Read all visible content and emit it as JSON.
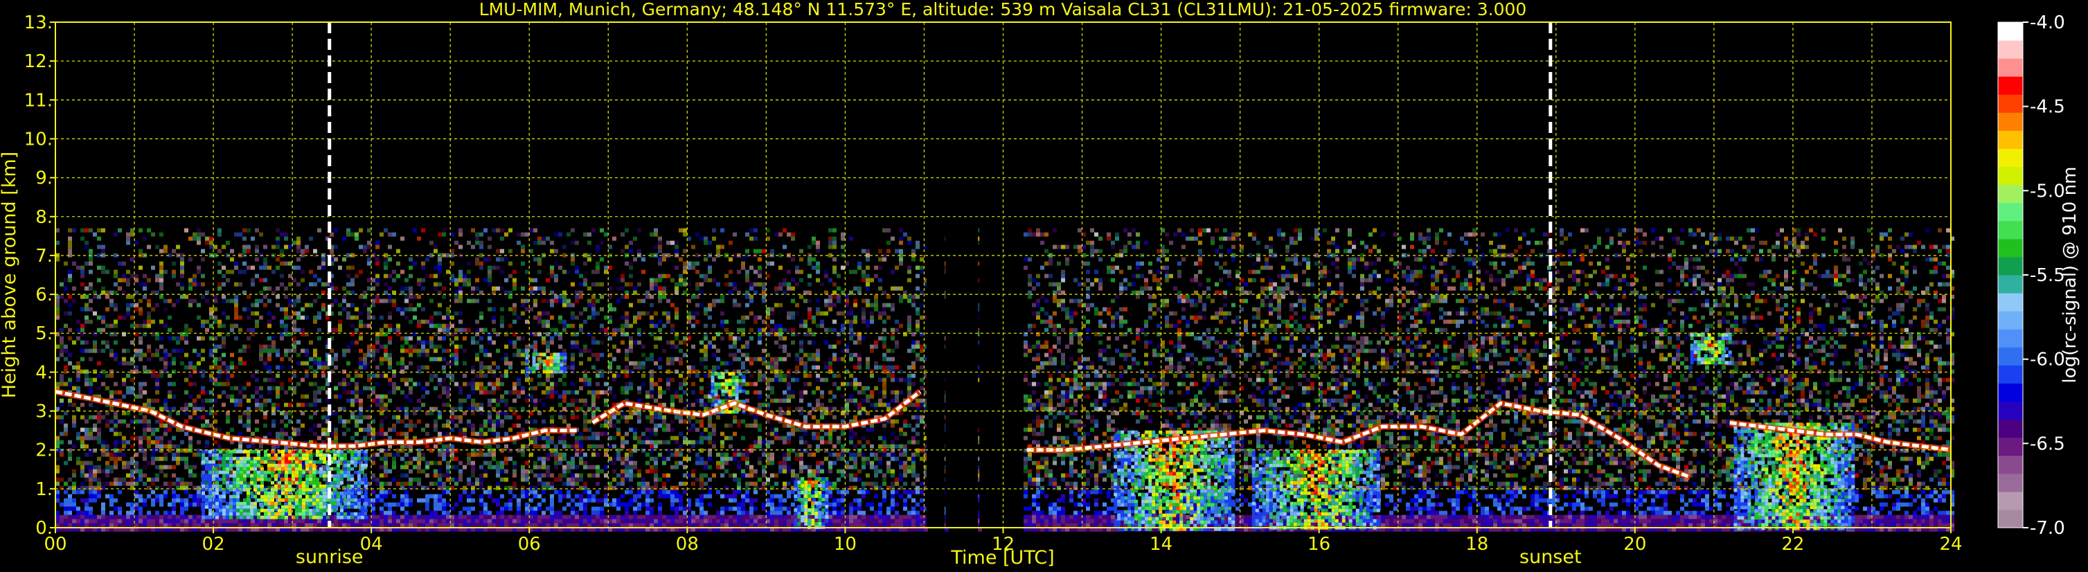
{
  "chart_data": {
    "type": "heatmap",
    "title": "LMU-MIM, Munich, Germany; 48.148° N 11.573° E, altitude: 539 m    Vaisala CL31 (CL31LMU): 21-05-2025    firmware: 3.000",
    "xlabel": "Time [UTC]",
    "ylabel": "Height above ground [km]",
    "xlim": [
      0,
      24
    ],
    "ylim": [
      0,
      13
    ],
    "x_ticks": [
      "00",
      "02",
      "04",
      "06",
      "08",
      "10",
      "12",
      "14",
      "16",
      "18",
      "20",
      "22",
      "24"
    ],
    "y_ticks": [
      "0.",
      "1.",
      "2.",
      "3.",
      "4.",
      "5.",
      "6.",
      "7.",
      "8.",
      "9.",
      "10.",
      "11.",
      "12.",
      "13."
    ],
    "grid": true,
    "colorbar": {
      "label": "log(rc-signal) @ 910 nm",
      "range": [
        -7.0,
        -4.0
      ],
      "ticks": [
        "-4.0",
        "-4.5",
        "-5.0",
        "-5.5",
        "-6.0",
        "-6.5",
        "-7.0"
      ],
      "colors": [
        "#a88aa0",
        "#b89ab0",
        "#9a6a9a",
        "#8a4a90",
        "#6a1a80",
        "#4a0080",
        "#2800c0",
        "#0000e0",
        "#1a40f0",
        "#3070f0",
        "#5090f8",
        "#70b0f8",
        "#90c8f8",
        "#30b0a0",
        "#10a050",
        "#20c020",
        "#40e050",
        "#60f080",
        "#a0f060",
        "#d0f000",
        "#f0f000",
        "#ffc000",
        "#ff8000",
        "#ff4000",
        "#ff0000",
        "#ff9090",
        "#ffc8c8",
        "#ffffff"
      ]
    },
    "measurement_top_km": 7.7,
    "data_gaps_utc": [
      [
        11.03,
        11.22
      ],
      [
        11.27,
        11.65
      ],
      [
        11.7,
        12.23
      ]
    ],
    "annotations": [
      {
        "label": "sunrise",
        "time_utc": 3.47
      },
      {
        "label": "sunset",
        "time_utc": 18.93
      }
    ],
    "cloud_layers": [
      {
        "x": [
          0.0,
          0.5,
          1.2,
          1.6,
          2.2,
          2.8,
          3.3,
          3.8,
          4.2,
          4.6,
          5.0,
          5.4,
          5.8,
          6.2,
          6.6
        ],
        "y": [
          3.5,
          3.3,
          3.0,
          2.6,
          2.3,
          2.2,
          2.1,
          2.1,
          2.2,
          2.2,
          2.3,
          2.2,
          2.3,
          2.5,
          2.5
        ]
      },
      {
        "x": [
          6.8,
          7.2,
          7.8,
          8.2,
          8.6,
          9.0,
          9.5,
          10.0,
          10.5,
          10.95
        ],
        "y": [
          2.7,
          3.2,
          3.0,
          2.9,
          3.2,
          2.9,
          2.6,
          2.6,
          2.8,
          3.5
        ]
      },
      {
        "x": [
          12.3,
          12.8,
          13.3,
          13.8,
          14.3,
          14.8,
          15.3,
          15.8,
          16.3,
          16.8,
          17.3,
          17.8,
          18.3,
          18.8,
          19.3,
          19.8,
          20.3,
          20.7
        ],
        "y": [
          2.0,
          2.0,
          2.1,
          2.2,
          2.3,
          2.4,
          2.5,
          2.4,
          2.2,
          2.6,
          2.6,
          2.4,
          3.2,
          3.0,
          2.9,
          2.3,
          1.6,
          1.3
        ]
      },
      {
        "x": [
          21.2,
          21.6,
          22.0,
          22.4,
          22.8,
          23.2,
          23.6,
          24.0
        ],
        "y": [
          2.7,
          2.6,
          2.5,
          2.4,
          2.4,
          2.2,
          2.1,
          2.0
        ]
      }
    ],
    "intense_plumes": [
      {
        "x": 2.9,
        "y": 0.3,
        "h": 1.7,
        "w": 2.1
      },
      {
        "x": 9.55,
        "y": 0.0,
        "h": 1.3,
        "w": 0.4
      },
      {
        "x": 14.15,
        "y": 0.0,
        "h": 2.5,
        "w": 1.5
      },
      {
        "x": 15.95,
        "y": 0.0,
        "h": 2.0,
        "w": 1.6
      },
      {
        "x": 22.0,
        "y": 0.0,
        "h": 2.7,
        "w": 1.5
      },
      {
        "x": 20.95,
        "y": 4.2,
        "h": 0.8,
        "w": 0.5
      },
      {
        "x": 6.2,
        "y": 4.0,
        "h": 0.5,
        "w": 0.5
      },
      {
        "x": 8.5,
        "y": 3.0,
        "h": 1.0,
        "w": 0.4
      }
    ]
  }
}
